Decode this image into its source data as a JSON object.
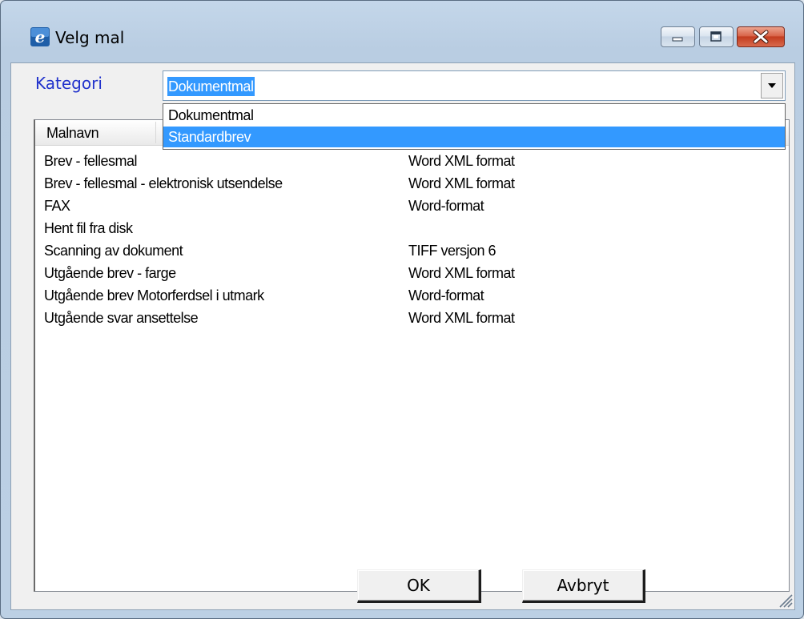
{
  "window": {
    "title": "Velg mal"
  },
  "category": {
    "label": "Kategori",
    "selected": "Dokumentmal",
    "options": [
      "Dokumentmal",
      "Standardbrev"
    ],
    "highlighted_option": "Standardbrev"
  },
  "list": {
    "column_header": "Malnavn",
    "rows": [
      {
        "name": "Brev - fellesmal",
        "format": "Word XML format"
      },
      {
        "name": "Brev - fellesmal - elektronisk utsendelse",
        "format": "Word XML format"
      },
      {
        "name": "FAX",
        "format": "Word-format"
      },
      {
        "name": "Hent fil fra disk",
        "format": ""
      },
      {
        "name": "Scanning av dokument",
        "format": "TIFF versjon 6"
      },
      {
        "name": "Utgående brev - farge",
        "format": "Word XML format"
      },
      {
        "name": "Utgående brev Motorferdsel i utmark",
        "format": "Word-format"
      },
      {
        "name": "Utgående svar ansettelse",
        "format": "Word XML format"
      }
    ]
  },
  "buttons": {
    "ok": "OK",
    "cancel": "Avbryt"
  },
  "icons": {
    "app": "app-e-icon",
    "minimize": "minimize-icon",
    "maximize": "maximize-icon",
    "close": "close-icon",
    "dropdown": "chevron-down-icon",
    "grip": "resize-grip-icon"
  },
  "colors": {
    "selection": "#3399ff",
    "label_blue": "#2233cc",
    "close_red": "#c33c1f"
  }
}
